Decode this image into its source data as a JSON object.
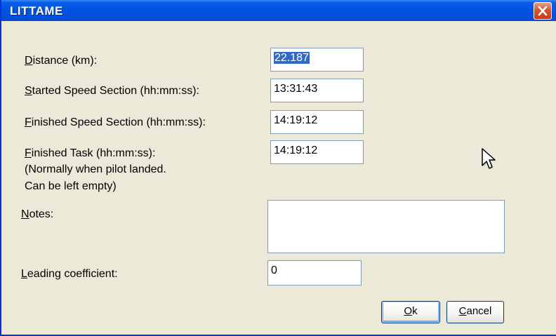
{
  "window": {
    "title": "LITTAME"
  },
  "icons": {
    "close": "close-icon",
    "cursor": "mouse-pointer-icon"
  },
  "form": {
    "distance": {
      "label_accel": "D",
      "label_rest": "istance (km):",
      "value": "22.187"
    },
    "started": {
      "label_accel": "S",
      "label_rest": "tarted Speed Section (hh:mm:ss):",
      "value": "13:31:43"
    },
    "finished_speed": {
      "label_accel": "F",
      "label_rest": "inished Speed Section (hh:mm:ss):",
      "value": "14:19:12"
    },
    "finished_task": {
      "label_accel": "F",
      "label_rest": "inished Task (hh:mm:ss):",
      "hint_line1": "(Normally when pilot landed.",
      "hint_line2": "Can be left empty)",
      "value": "14:19:12"
    },
    "notes": {
      "label_accel": "N",
      "label_rest": "otes:",
      "value": ""
    },
    "leading": {
      "label_accel": "L",
      "label_rest": "eading coefficient:",
      "value": "0"
    }
  },
  "buttons": {
    "ok": {
      "accel": "O",
      "rest": "k"
    },
    "cancel": {
      "accel": "C",
      "rest": "ancel"
    }
  },
  "colors": {
    "titlebar": "#0054e3",
    "window_bg": "#ece9d8",
    "selection": "#316ac5",
    "close_button": "#d8542f"
  }
}
